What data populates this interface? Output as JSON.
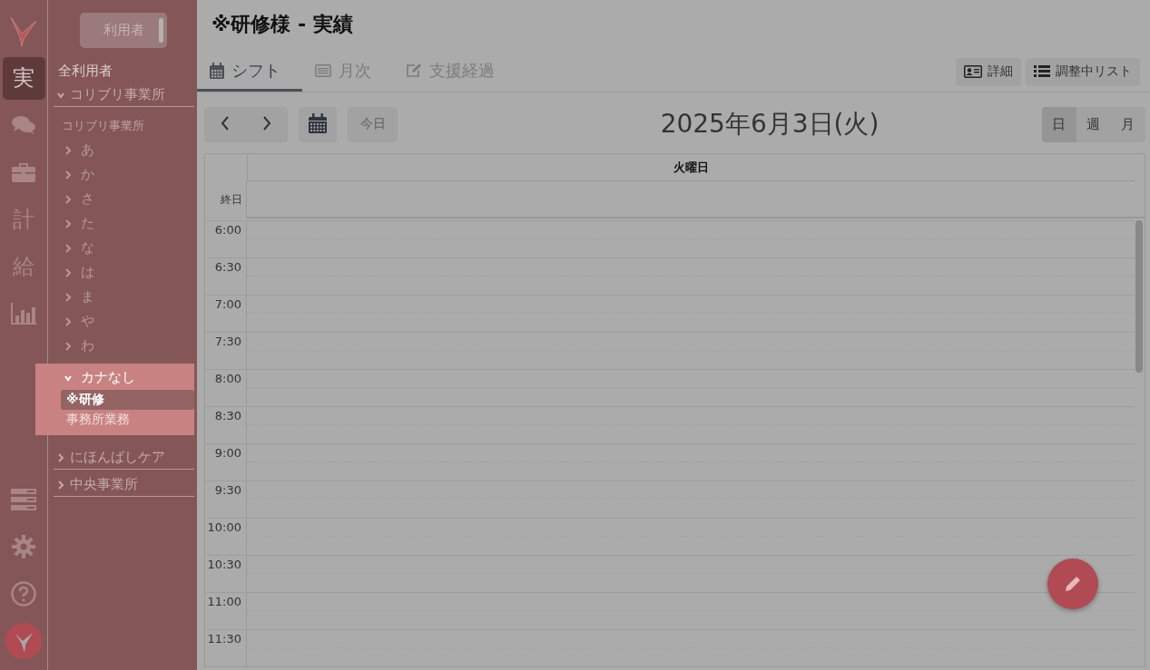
{
  "rail": {
    "top": [
      {
        "kind": "logo"
      },
      {
        "kind": "text",
        "label": "実",
        "selected": true
      },
      {
        "kind": "chat"
      },
      {
        "kind": "briefcase"
      },
      {
        "kind": "text",
        "label": "計",
        "selected": false
      },
      {
        "kind": "text",
        "label": "給",
        "selected": false
      },
      {
        "kind": "chart"
      }
    ],
    "bottom": [
      {
        "kind": "list"
      },
      {
        "kind": "gear"
      },
      {
        "kind": "help"
      },
      {
        "kind": "avatar"
      }
    ]
  },
  "nav": {
    "toggle": "利用者",
    "all_users": "全利用者",
    "offices": [
      {
        "name": "コリブリ事業所",
        "expanded": true,
        "subtitle": "コリブリ事業所",
        "groups": [
          {
            "label": "あ",
            "expanded": false,
            "spotlight": false
          },
          {
            "label": "か",
            "expanded": false,
            "spotlight": false
          },
          {
            "label": "さ",
            "expanded": false,
            "spotlight": false
          },
          {
            "label": "た",
            "expanded": false,
            "spotlight": false
          },
          {
            "label": "な",
            "expanded": false,
            "spotlight": false
          },
          {
            "label": "は",
            "expanded": false,
            "spotlight": false
          },
          {
            "label": "ま",
            "expanded": false,
            "spotlight": false
          },
          {
            "label": "や",
            "expanded": false,
            "spotlight": false
          },
          {
            "label": "わ",
            "expanded": false,
            "spotlight": false
          },
          {
            "label": "カナなし",
            "expanded": true,
            "spotlight": true,
            "users": [
              {
                "name": "※研修",
                "selected": true
              },
              {
                "name": "事務所業務",
                "selected": false
              }
            ]
          }
        ]
      },
      {
        "name": "にほんばしケア",
        "expanded": false
      },
      {
        "name": "中央事業所",
        "expanded": false
      }
    ]
  },
  "main": {
    "title": "※研修様 - 実績",
    "tabs": [
      {
        "kind": "calendar",
        "label": "シフト",
        "selected": true
      },
      {
        "kind": "list",
        "label": "月次",
        "selected": false
      },
      {
        "kind": "edit",
        "label": "支援経過",
        "selected": false
      }
    ],
    "header_buttons": [
      {
        "kind": "card",
        "label": "詳細"
      },
      {
        "kind": "list",
        "label": "調整中リスト"
      }
    ],
    "toolbar": {
      "today": {
        "label": "今日",
        "disabled": true
      },
      "date": "2025年6月3日(火)",
      "views": [
        {
          "label": "日",
          "selected": true
        },
        {
          "label": "週",
          "selected": false
        },
        {
          "label": "月",
          "selected": false
        }
      ]
    },
    "calendar": {
      "day": "火曜日",
      "all_day": "終日",
      "times": [
        "6:00",
        "6:30",
        "7:00",
        "7:30",
        "8:00",
        "8:30",
        "9:00",
        "9:30",
        "10:00",
        "10:30",
        "11:00",
        "11:30"
      ]
    }
  }
}
